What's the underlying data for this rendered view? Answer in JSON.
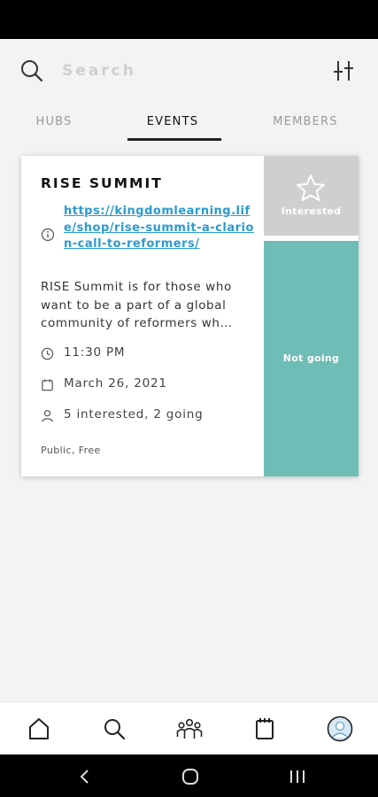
{
  "search": {
    "placeholder": "Search"
  },
  "tabs": [
    {
      "label": "HUBS",
      "active": false
    },
    {
      "label": "EVENTS",
      "active": true
    },
    {
      "label": "MEMBERS",
      "active": false
    }
  ],
  "event": {
    "title": "RISE SUMMIT",
    "link": "https://kingdomlearning.life/shop/rise-summit-a-clarion-call-to-reformers/",
    "description": "RISE Summit is for those who want to be a part of a global community of reformers wh…",
    "time": "11:30 PM",
    "date": "March 26, 2021",
    "attendance": "5 interested, 2 going",
    "visibility": "Public, Free",
    "interested_label": "Interested",
    "not_going_label": "Not going"
  },
  "icons": {
    "search": "search-icon",
    "filter": "filter-icon",
    "info": "info-icon",
    "clock": "clock-icon",
    "calendar": "calendar-icon",
    "person": "person-icon",
    "star": "star-icon",
    "nav": [
      "home-icon",
      "search-icon",
      "groups-icon",
      "calendar-icon",
      "profile-avatar-icon"
    ]
  },
  "colors": {
    "accent_link": "#2a9bd1",
    "interested_bg": "#d0cece",
    "not_going_bg": "#6fbdb7",
    "page_bg": "#f3f3f3"
  }
}
